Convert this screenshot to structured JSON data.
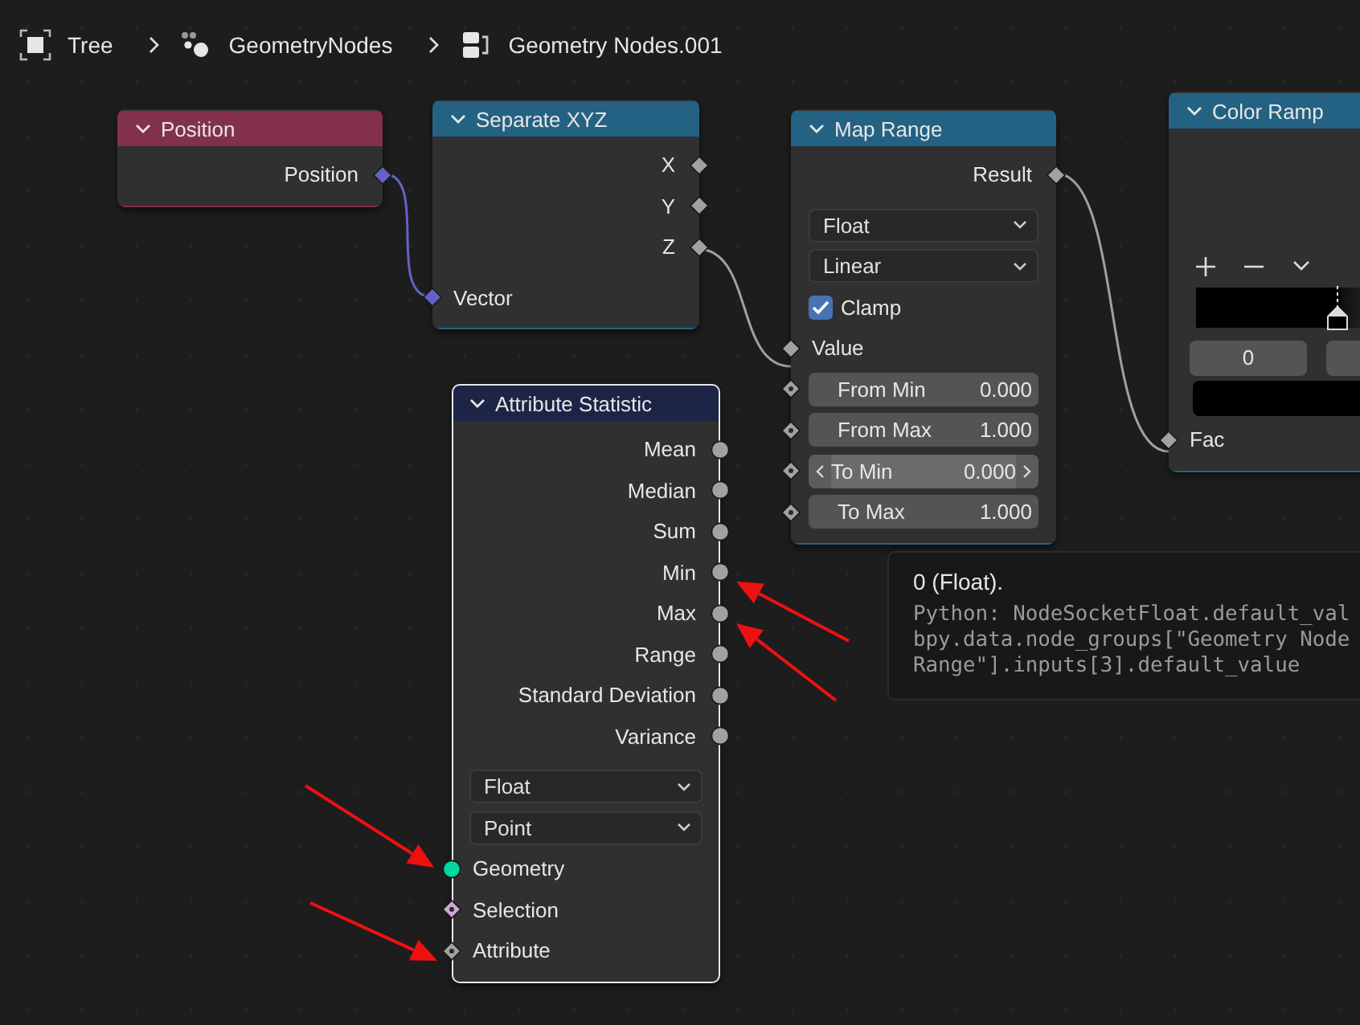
{
  "breadcrumb": [
    {
      "kind": "frame",
      "label": "Tree"
    },
    {
      "kind": "nodes",
      "label": "GeometryNodes"
    },
    {
      "kind": "nodetree",
      "label": "Geometry Nodes.001"
    }
  ],
  "nodes": [
    {
      "title": "Position",
      "kind": "input",
      "selected": false,
      "rows": [
        {
          "kind": "output",
          "label": "Position",
          "socket": {
            "kind": "vector"
          }
        }
      ]
    },
    {
      "title": "Separate XYZ",
      "kind": "converter",
      "selected": false,
      "rows": [
        {
          "kind": "output",
          "label": "X",
          "socket": {
            "kind": "float"
          }
        },
        {
          "kind": "output",
          "label": "Y",
          "socket": {
            "kind": "float"
          }
        },
        {
          "kind": "output",
          "label": "Z",
          "socket": {
            "kind": "float"
          }
        },
        {
          "kind": "input",
          "label": "Vector",
          "socket": {
            "kind": "vector"
          }
        }
      ]
    },
    {
      "title": "Map Range",
      "kind": "converter",
      "selected": false,
      "rows": [
        {
          "kind": "output",
          "label": "Result",
          "socket": {
            "kind": "float"
          }
        },
        {
          "kind": "dropdown",
          "label": "Float"
        },
        {
          "kind": "dropdown",
          "label": "Linear"
        },
        {
          "kind": "checkbox",
          "label": "Clamp",
          "checked": true
        },
        {
          "kind": "input",
          "label": "Value",
          "socket": {
            "kind": "float"
          }
        },
        {
          "kind": "field",
          "label": "From Min",
          "value": "0.000",
          "socket": {
            "kind": "float_field"
          },
          "hovered": false
        },
        {
          "kind": "field",
          "label": "From Max",
          "value": "1.000",
          "socket": {
            "kind": "float_field"
          },
          "hovered": false
        },
        {
          "kind": "field",
          "label": "To Min",
          "value": "0.000",
          "socket": {
            "kind": "float_field"
          },
          "hovered": true
        },
        {
          "kind": "field",
          "label": "To Max",
          "value": "1.000",
          "socket": {
            "kind": "float_field"
          },
          "hovered": false
        }
      ]
    },
    {
      "title": "Color Ramp",
      "kind": "converter",
      "selected": false,
      "rows": [
        {
          "kind": "ramp_tools"
        },
        {
          "kind": "ramp"
        },
        {
          "kind": "ramp_fields",
          "fields": [
            {
              "kind": "text",
              "text": "0"
            },
            {
              "kind": "cut"
            }
          ]
        },
        {
          "kind": "swatch",
          "color": "#000000"
        },
        {
          "kind": "input",
          "label": "Fac",
          "socket": {
            "kind": "float"
          }
        }
      ]
    },
    {
      "title": "Attribute Statistic",
      "kind": "attribute",
      "selected": true,
      "rows": [
        {
          "kind": "output",
          "label": "Mean",
          "socket": {
            "kind": "float_single"
          }
        },
        {
          "kind": "output",
          "label": "Median",
          "socket": {
            "kind": "float_single"
          }
        },
        {
          "kind": "output",
          "label": "Sum",
          "socket": {
            "kind": "float_single"
          }
        },
        {
          "kind": "output",
          "label": "Min",
          "socket": {
            "kind": "float_single"
          }
        },
        {
          "kind": "output",
          "label": "Max",
          "socket": {
            "kind": "float_single"
          }
        },
        {
          "kind": "output",
          "label": "Range",
          "socket": {
            "kind": "float_single"
          }
        },
        {
          "kind": "output",
          "label": "Standard Deviation",
          "socket": {
            "kind": "float_single"
          }
        },
        {
          "kind": "output",
          "label": "Variance",
          "socket": {
            "kind": "float_single"
          }
        },
        {
          "kind": "dropdown",
          "label": "Float"
        },
        {
          "kind": "dropdown",
          "label": "Point"
        },
        {
          "kind": "input",
          "label": "Geometry",
          "socket": {
            "kind": "geometry"
          }
        },
        {
          "kind": "input",
          "label": "Selection",
          "socket": {
            "kind": "bool_field"
          }
        },
        {
          "kind": "input",
          "label": "Attribute",
          "socket": {
            "kind": "float_field"
          }
        }
      ]
    }
  ],
  "links": [
    {
      "kind": "vector"
    },
    {
      "kind": "float"
    },
    {
      "kind": "float"
    }
  ],
  "tooltip": {
    "title": "0 (Float).",
    "lines": [
      "Python: NodeSocketFloat.default_val",
      "bpy.data.node_groups[\"Geometry Node",
      "Range\"].inputs[3].default_value"
    ]
  },
  "annotations": [
    {
      "kind": "arrow"
    },
    {
      "kind": "arrow"
    },
    {
      "kind": "arrow"
    },
    {
      "kind": "arrow"
    }
  ]
}
